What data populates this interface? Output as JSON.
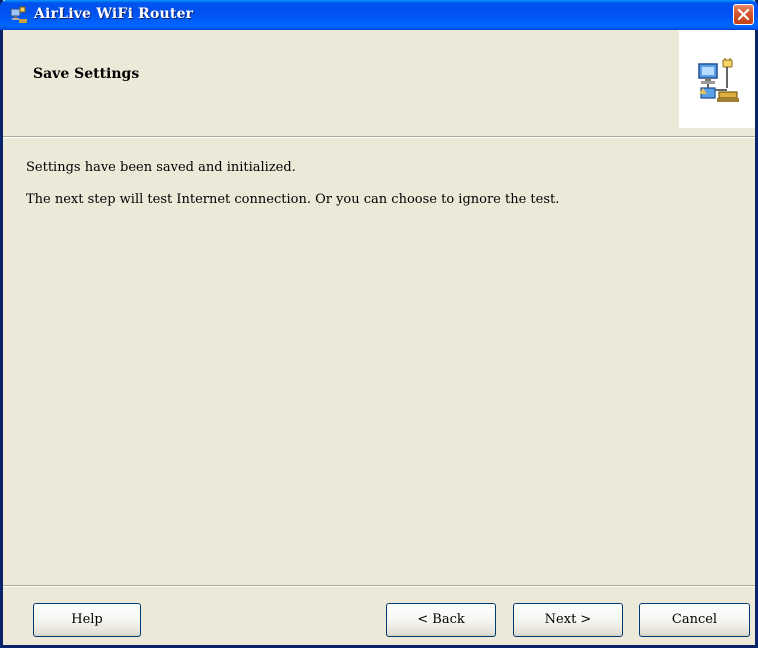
{
  "window": {
    "title": "AirLive WiFi Router"
  },
  "header": {
    "title": "Save Settings",
    "image_icon": "network-computers-icon"
  },
  "content": {
    "line1": "Settings have been saved and initialized.",
    "line2": "The next step will test Internet connection. Or you can choose to ignore the test."
  },
  "buttons": {
    "help": "Help",
    "back": "< Back",
    "next": "Next >",
    "cancel": "Cancel"
  },
  "colors": {
    "titlebar": "#0053ee",
    "close": "#d5542e",
    "dialog_bg": "#ece9d8"
  }
}
